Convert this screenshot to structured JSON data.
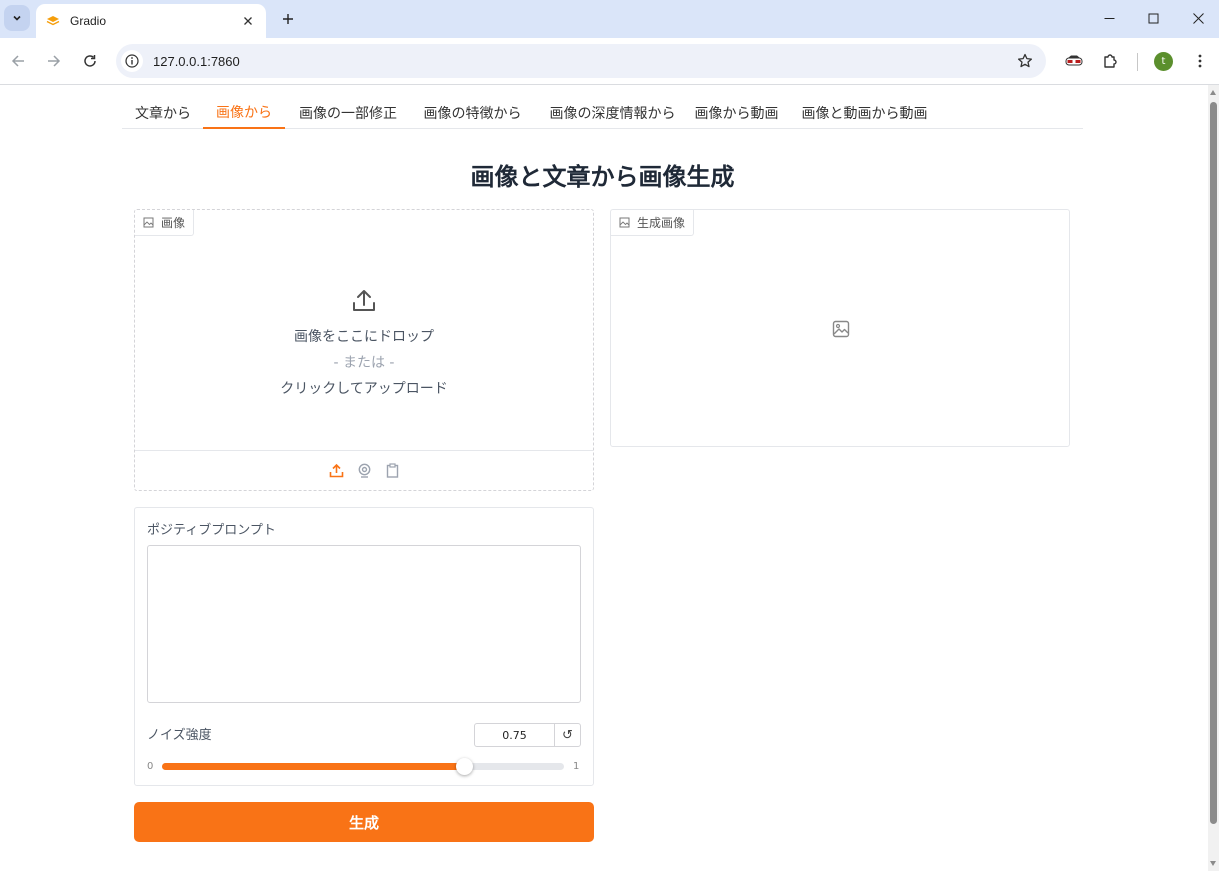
{
  "browser": {
    "tab_title": "Gradio",
    "url": "127.0.0.1:7860",
    "profile_initial": "t"
  },
  "colors": {
    "accent": "#f97316",
    "tabstrip": "#dae5f9"
  },
  "nav_tabs": [
    {
      "label": "文章から",
      "active": false
    },
    {
      "label": "画像から",
      "active": true
    },
    {
      "label": "画像の一部修正",
      "active": false
    },
    {
      "label": "画像の特徴から",
      "active": false
    },
    {
      "label": "画像の深度情報から",
      "active": false
    },
    {
      "label": "画像から動画",
      "active": false
    },
    {
      "label": "画像と動画から動画",
      "active": false
    }
  ],
  "page_title": "画像と文章から画像生成",
  "input_image": {
    "label": "画像",
    "drop_text": "画像をここにドロップ",
    "or_text": "- または -",
    "click_text": "クリックしてアップロード",
    "sources": [
      "upload-icon",
      "webcam-icon",
      "clipboard-icon"
    ]
  },
  "output_image": {
    "label": "生成画像"
  },
  "prompt": {
    "label": "ポジティブプロンプト",
    "value": ""
  },
  "noise": {
    "label": "ノイズ強度",
    "value": "0.75",
    "fraction": 0.75,
    "min": "0",
    "max": "1",
    "reset": "↺"
  },
  "generate_button": "生成"
}
